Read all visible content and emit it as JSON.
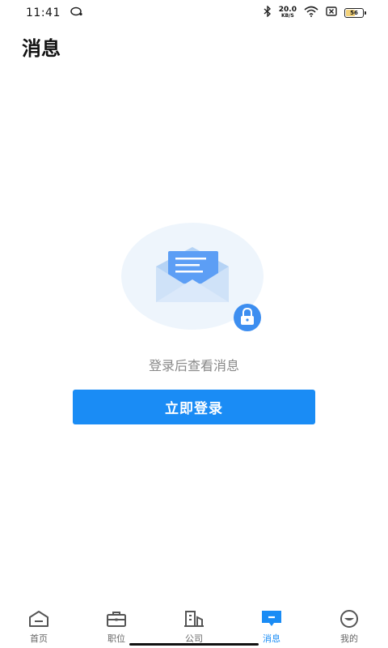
{
  "status_bar": {
    "time": "11:41",
    "net_speed_value": "20.0",
    "net_speed_unit": "KB/S",
    "battery": "56",
    "battery_level": 0.56
  },
  "page": {
    "title": "消息"
  },
  "empty_state": {
    "message": "登录后查看消息",
    "login_button": "立即登录"
  },
  "bottom_nav": {
    "active": "消息",
    "items": [
      {
        "label": "首页",
        "icon": "home-icon"
      },
      {
        "label": "职位",
        "icon": "briefcase-icon"
      },
      {
        "label": "公司",
        "icon": "building-icon"
      },
      {
        "label": "消息",
        "icon": "message-icon"
      },
      {
        "label": "我的",
        "icon": "profile-icon"
      }
    ]
  },
  "colors": {
    "accent": "#1a8cf5",
    "hint_text": "#888888",
    "nav_inactive": "#666666"
  }
}
